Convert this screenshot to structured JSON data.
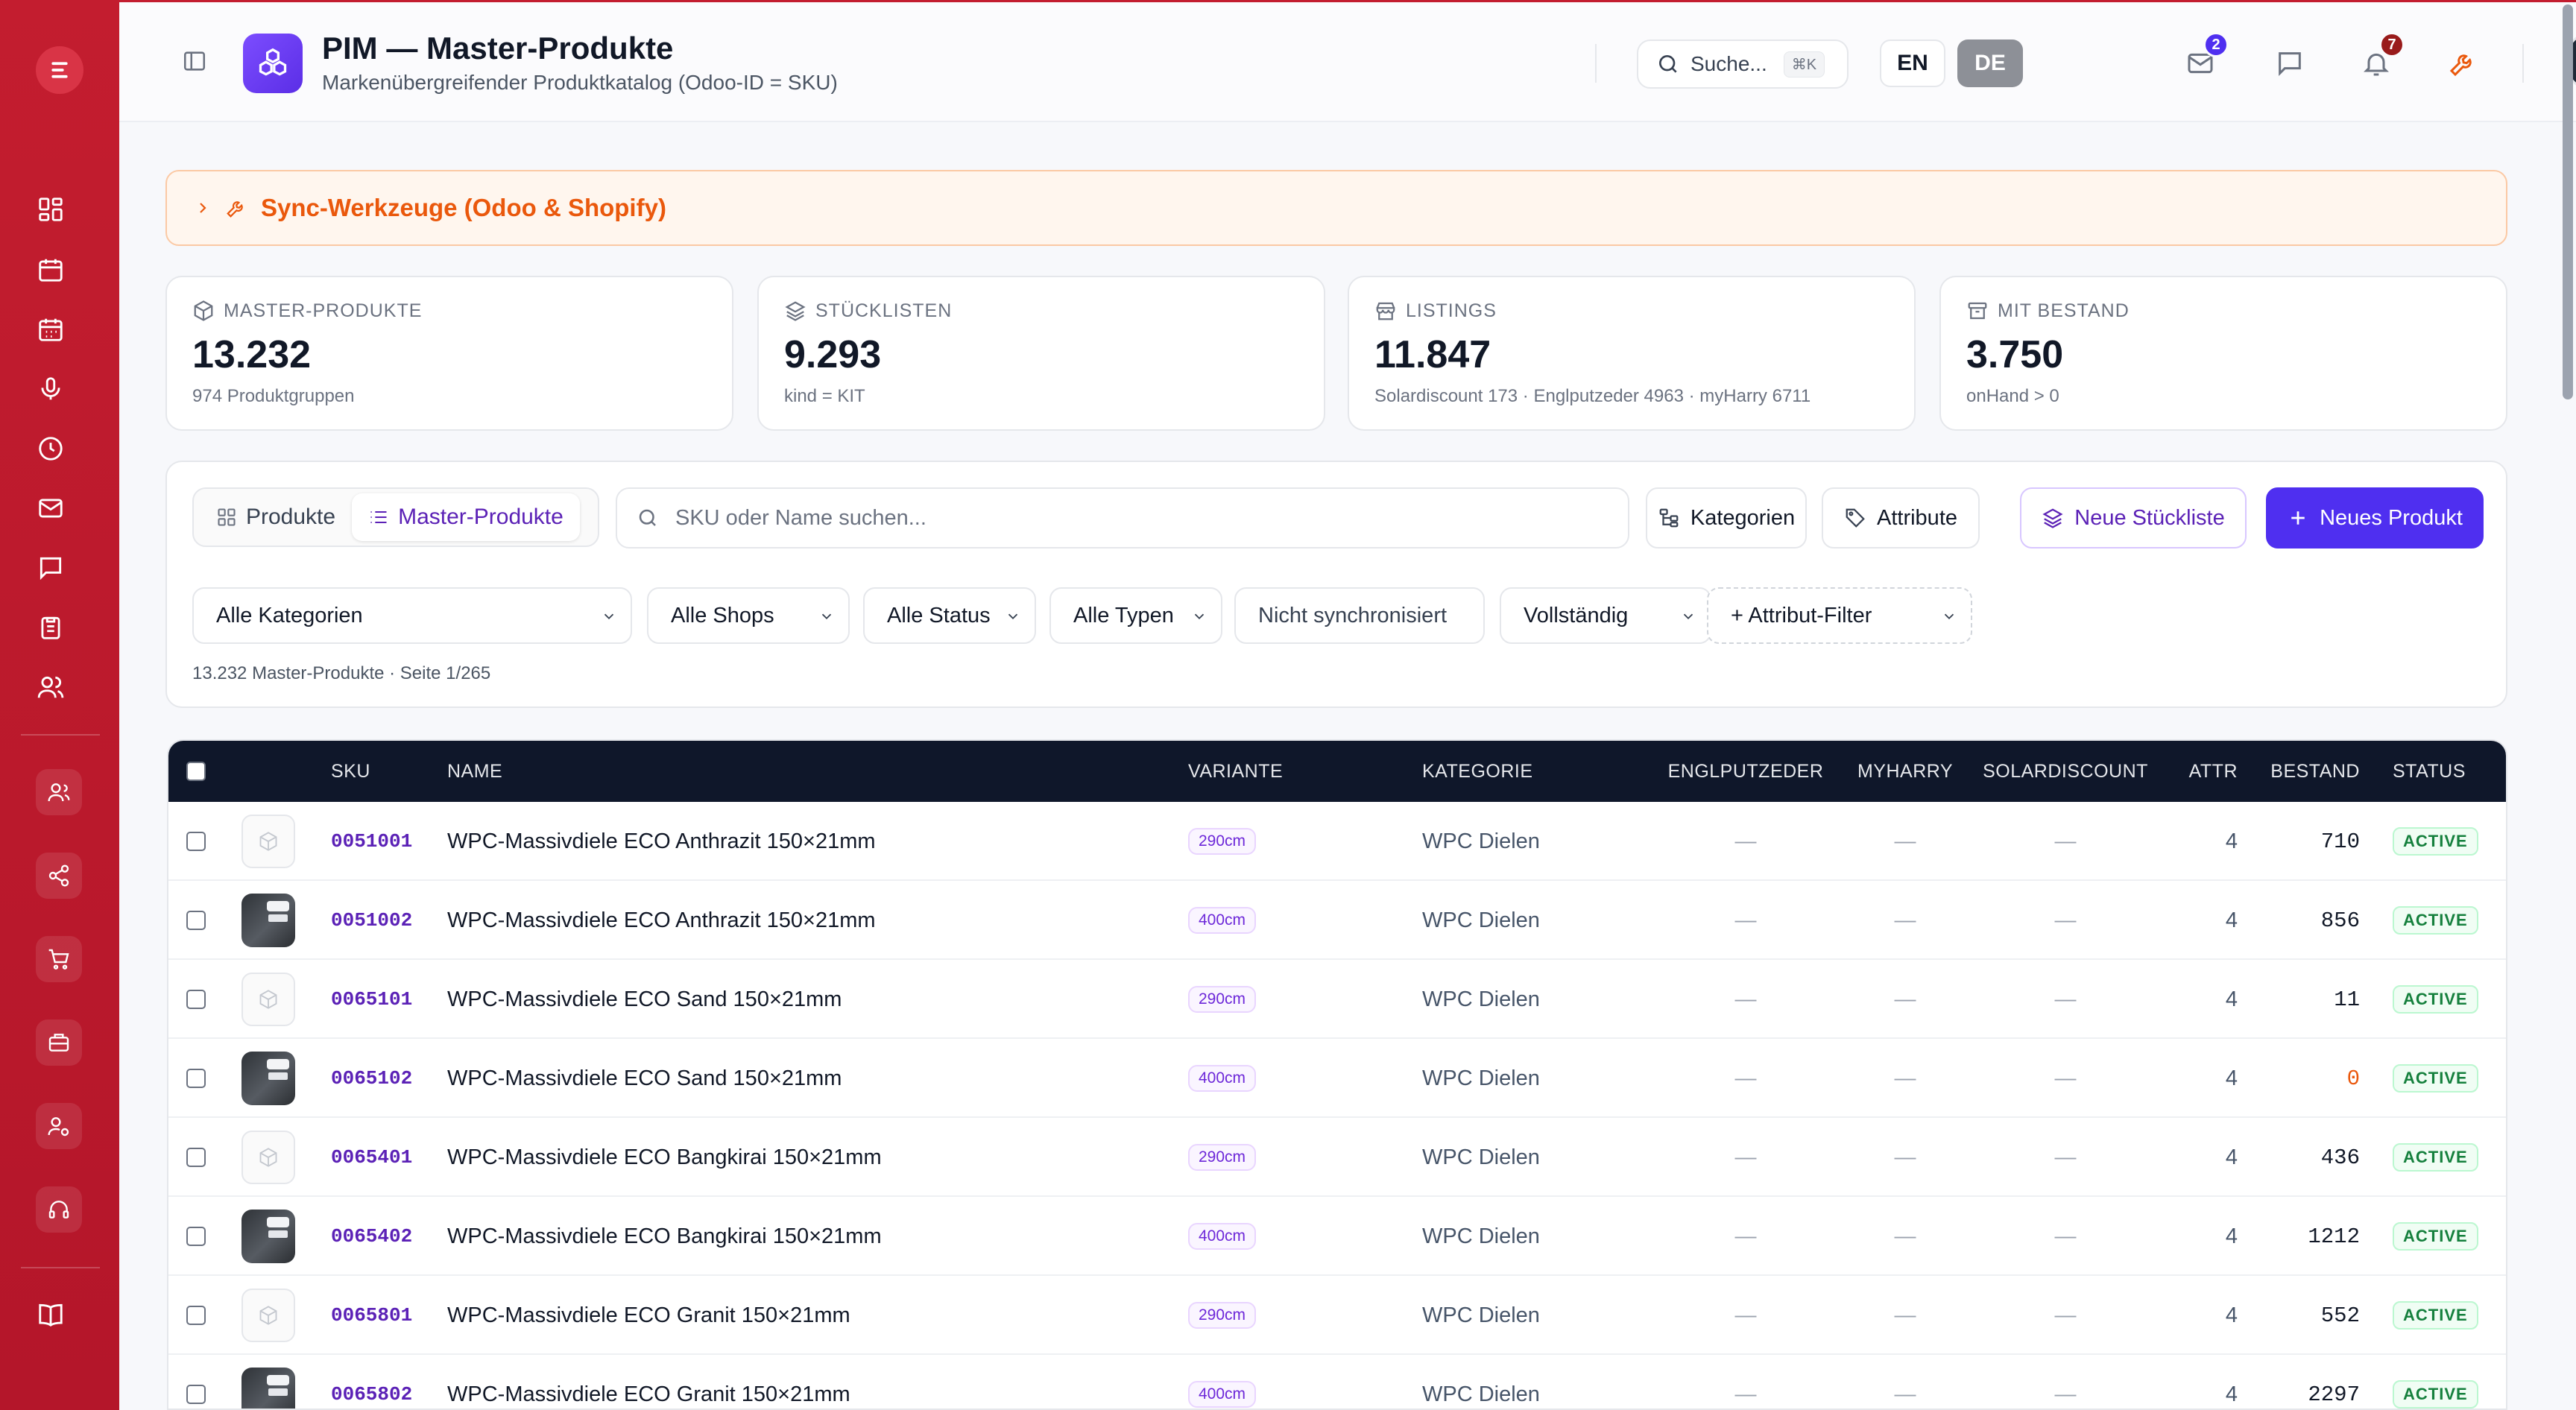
{
  "sidebar": {
    "logo": "brand-logo",
    "items": [
      "dashboard-icon",
      "calendar-icon",
      "calendar-grid-icon",
      "microphone-icon",
      "clock-icon",
      "mail-icon",
      "chat-icon",
      "clipboard-icon",
      "users-icon"
    ],
    "tools": [
      "user-group-icon",
      "share-icon",
      "cart-icon",
      "briefcase-icon",
      "user-cog-icon",
      "headset-icon"
    ],
    "bottom": "book-icon"
  },
  "header": {
    "title": "PIM — Master-Produkte",
    "subtitle": "Markenübergreifender Produktkatalog (Odoo-ID = SKU)",
    "search_label": "Suche...",
    "search_shortcut": "⌘K",
    "lang_en": "EN",
    "lang_de": "DE",
    "mail_badge": "2",
    "notifications_badge": "7",
    "colors": {
      "accent": "#c31d2f",
      "brand_purple": "#4f2ff0"
    }
  },
  "sync": {
    "label": "Sync-Werkzeuge (Odoo & Shopify)"
  },
  "stats": [
    {
      "label": "MASTER-PRODUKTE",
      "value": "13.232",
      "sub": "974 Produktgruppen",
      "icon": "box-icon"
    },
    {
      "label": "STÜCKLISTEN",
      "value": "9.293",
      "sub": "kind = KIT",
      "icon": "layers-icon"
    },
    {
      "label": "LISTINGS",
      "value": "11.847",
      "sub": "Solardiscount 173 · Englputzeder 4963 · myHarry 6711",
      "icon": "store-icon"
    },
    {
      "label": "MIT BESTAND",
      "value": "3.750",
      "sub": "onHand > 0",
      "icon": "archive-icon"
    }
  ],
  "toolbar": {
    "tab_products": "Produkte",
    "tab_master": "Master-Produkte",
    "search_placeholder": "SKU oder Name suchen...",
    "categories_button": "Kategorien",
    "attributes_button": "Attribute",
    "new_bom_button": "Neue Stückliste",
    "new_product_button": "Neues Produkt"
  },
  "filters": {
    "category": "Alle Kategorien",
    "shops": "Alle Shops",
    "status": "Alle Status",
    "types": "Alle Typen",
    "not_synced": "Nicht synchronisiert",
    "completeness": "Vollständig",
    "attribute_filter": "+ Attribut-Filter",
    "result_info": "13.232 Master-Produkte · Seite 1/265"
  },
  "table": {
    "columns": {
      "sku": "SKU",
      "name": "NAME",
      "variant": "VARIANTE",
      "category": "KATEGORIE",
      "englputzeder": "ENGLPUTZEDER",
      "myharry": "MYHARRY",
      "solardiscount": "SOLARDISCOUNT",
      "attr": "ATTR",
      "stock": "BESTAND",
      "status": "STATUS"
    },
    "rows": [
      {
        "image": "placeholder",
        "sku": "0051001",
        "name": "WPC-Massivdiele ECO Anthrazit 150×21mm",
        "variant": "290cm",
        "category": "WPC Dielen",
        "englputzeder": "—",
        "myharry": "—",
        "solardiscount": "—",
        "attr": "4",
        "stock": "710",
        "status": "ACTIVE"
      },
      {
        "image": "photo",
        "sku": "0051002",
        "name": "WPC-Massivdiele ECO Anthrazit 150×21mm",
        "variant": "400cm",
        "category": "WPC Dielen",
        "englputzeder": "—",
        "myharry": "—",
        "solardiscount": "—",
        "attr": "4",
        "stock": "856",
        "status": "ACTIVE"
      },
      {
        "image": "placeholder",
        "sku": "0065101",
        "name": "WPC-Massivdiele ECO Sand 150×21mm",
        "variant": "290cm",
        "category": "WPC Dielen",
        "englputzeder": "—",
        "myharry": "—",
        "solardiscount": "—",
        "attr": "4",
        "stock": "11",
        "status": "ACTIVE"
      },
      {
        "image": "photo",
        "sku": "0065102",
        "name": "WPC-Massivdiele ECO Sand 150×21mm",
        "variant": "400cm",
        "category": "WPC Dielen",
        "englputzeder": "—",
        "myharry": "—",
        "solardiscount": "—",
        "attr": "4",
        "stock": "0",
        "status": "ACTIVE"
      },
      {
        "image": "placeholder",
        "sku": "0065401",
        "name": "WPC-Massivdiele ECO Bangkirai 150×21mm",
        "variant": "290cm",
        "category": "WPC Dielen",
        "englputzeder": "—",
        "myharry": "—",
        "solardiscount": "—",
        "attr": "4",
        "stock": "436",
        "status": "ACTIVE"
      },
      {
        "image": "photo",
        "sku": "0065402",
        "name": "WPC-Massivdiele ECO Bangkirai 150×21mm",
        "variant": "400cm",
        "category": "WPC Dielen",
        "englputzeder": "—",
        "myharry": "—",
        "solardiscount": "—",
        "attr": "4",
        "stock": "1212",
        "status": "ACTIVE"
      },
      {
        "image": "placeholder",
        "sku": "0065801",
        "name": "WPC-Massivdiele ECO Granit 150×21mm",
        "variant": "290cm",
        "category": "WPC Dielen",
        "englputzeder": "—",
        "myharry": "—",
        "solardiscount": "—",
        "attr": "4",
        "stock": "552",
        "status": "ACTIVE"
      },
      {
        "image": "photo",
        "sku": "0065802",
        "name": "WPC-Massivdiele ECO Granit 150×21mm",
        "variant": "400cm",
        "category": "WPC Dielen",
        "englputzeder": "—",
        "myharry": "—",
        "solardiscount": "—",
        "attr": "4",
        "stock": "2297",
        "status": "ACTIVE"
      }
    ]
  }
}
